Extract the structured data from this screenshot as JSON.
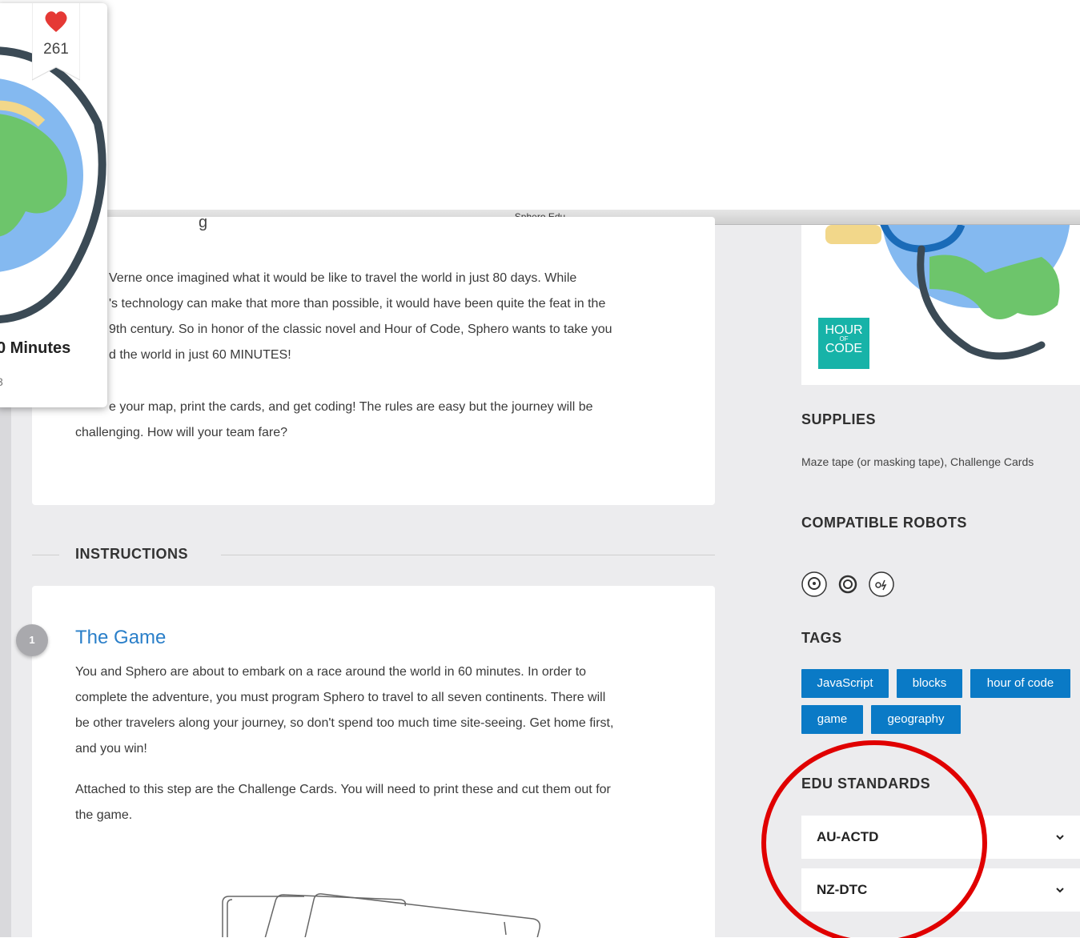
{
  "window": {
    "title": "Sphero Edu"
  },
  "popup": {
    "likes": "261",
    "title": "0 Minutes",
    "subtitle": "3"
  },
  "description": {
    "partial_heading": "g",
    "lines": [
      "Verne once imagined what it would be like to travel the world in just 80 days. While",
      "'s technology can make that more than possible, it would have been quite the feat in the",
      "9th century. So in honor of the classic novel and Hour of Code, Sphero wants to take you",
      "d the world in just 60 MINUTES!"
    ],
    "line5": "e your map, print the cards, and get coding! The rules are easy but the journey will be",
    "line6": "challenging. How will your team fare?"
  },
  "instructions": {
    "heading": "INSTRUCTIONS",
    "step": {
      "number": "1",
      "title": "The Game",
      "paragraph1": [
        "You and Sphero are about to embark on a race around the world in 60 minutes. In order to",
        "complete the adventure, you must program Sphero to travel to all seven continents. There will",
        "be other travelers along your journey, so don't spend too much time site-seeing. Get home first,",
        "and you win!"
      ],
      "paragraph2": [
        "Attached to this step are the Challenge Cards. You will need to print these and cut them out for",
        "the game."
      ]
    }
  },
  "sidebar": {
    "badge": {
      "line1": "HOUR",
      "line2": "OF",
      "line3": "CODE",
      "color": "#17b3a8"
    },
    "supplies": {
      "heading": "SUPPLIES",
      "text": "Maze tape (or masking tape), Challenge Cards"
    },
    "robots": {
      "heading": "COMPATIBLE ROBOTS",
      "icons": [
        "sphero-robot-icon",
        "sphero-mini-icon",
        "sphero-bolt-icon"
      ]
    },
    "tags": {
      "heading": "TAGS",
      "items": [
        "JavaScript",
        "blocks",
        "hour of code",
        "game",
        "geography"
      ],
      "color": "#0a7ac6"
    },
    "standards": {
      "heading": "EDU STANDARDS",
      "items": [
        "AU-ACTD",
        "NZ-DTC"
      ]
    }
  },
  "colors": {
    "accent": "#2a7fc9",
    "annotation": "#e00000",
    "heart": "#e53935"
  }
}
